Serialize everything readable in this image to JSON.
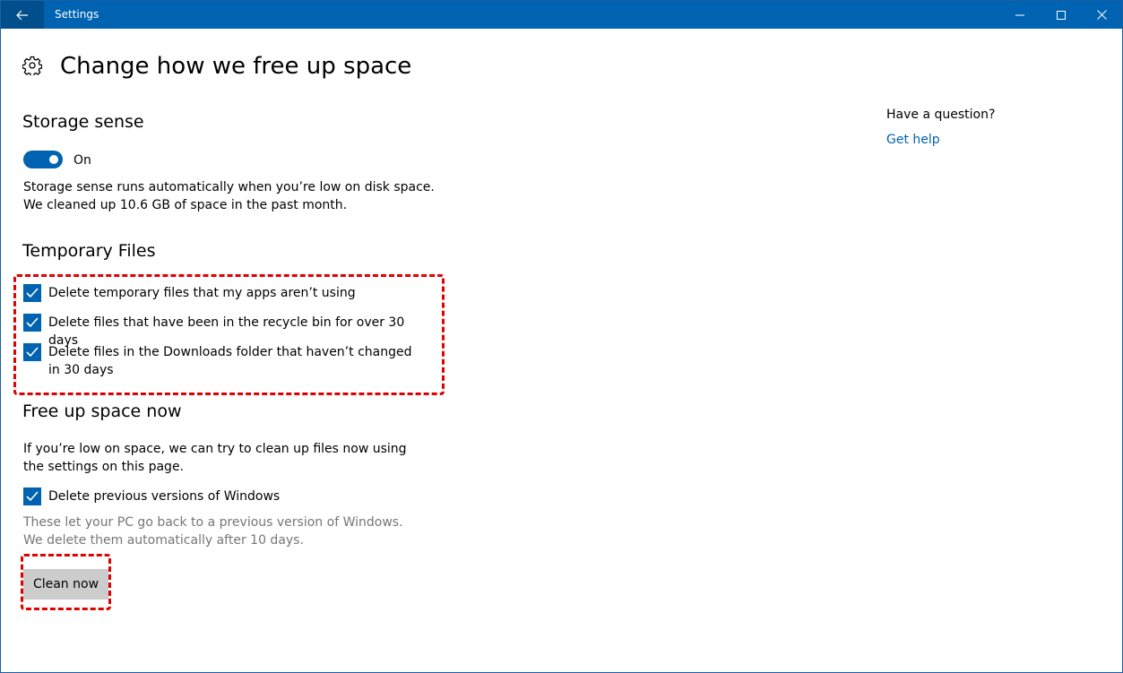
{
  "window": {
    "title": "Settings"
  },
  "page": {
    "title": "Change how we free up space"
  },
  "storage_sense": {
    "heading": "Storage sense",
    "toggle_state": "On",
    "toggle_on": true,
    "description_line1": "Storage sense runs automatically when you’re low on disk space.",
    "description_line2": "We cleaned up 10.6 GB of space in the past month."
  },
  "temporary_files": {
    "heading": "Temporary Files",
    "options": [
      {
        "label": "Delete temporary files that my apps aren’t using",
        "checked": true
      },
      {
        "label": "Delete files that have been in the recycle bin for over 30 days",
        "checked": true
      },
      {
        "label": "Delete files in the Downloads folder that haven’t changed in 30 days",
        "checked": true
      }
    ]
  },
  "free_up_now": {
    "heading": "Free up space now",
    "description": "If you’re low on space, we can try to clean up files now using the settings on this page.",
    "option": {
      "label": "Delete previous versions of Windows",
      "checked": true
    },
    "option_note": "These let your PC go back to a previous version of Windows. We delete them automatically after 10 days.",
    "button_label": "Clean now"
  },
  "sidebar": {
    "question": "Have a question?",
    "help_link": "Get help"
  },
  "colors": {
    "accent": "#0063b1",
    "titlebar": "#0063b1",
    "highlight": "#e00000",
    "button_bg": "#cccccc",
    "muted_text": "#767676"
  },
  "icons": {
    "back": "back-arrow-icon",
    "page": "gear-icon",
    "minimize": "minimize-icon",
    "maximize": "maximize-icon",
    "close": "close-icon",
    "check": "checkmark-icon"
  }
}
